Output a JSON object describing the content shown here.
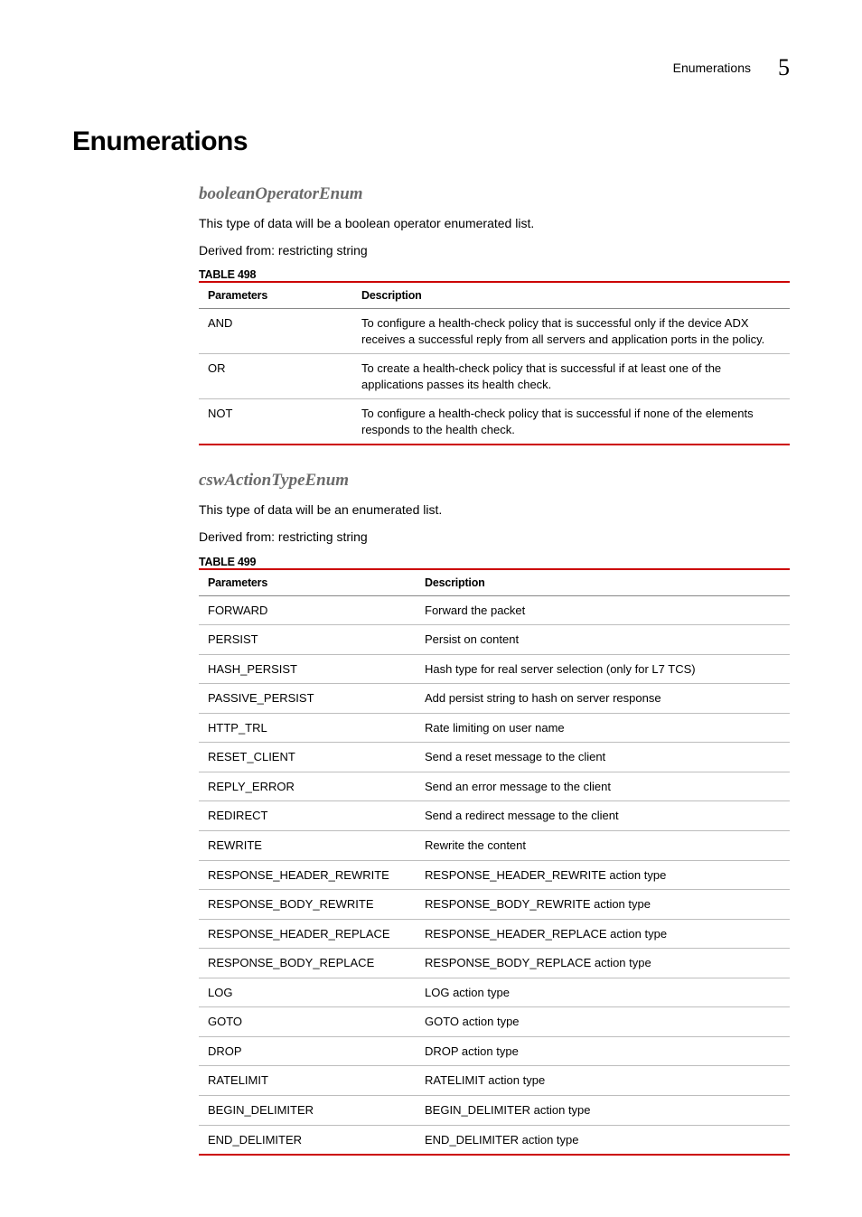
{
  "header": {
    "section": "Enumerations",
    "chapter_number": "5"
  },
  "title": "Enumerations",
  "sections": [
    {
      "heading": "booleanOperatorEnum",
      "intro": "This type of data will be a boolean operator enumerated list.",
      "derived": "Derived from: restricting string",
      "table_label": "TABLE 498",
      "table_class": "t498",
      "columns": [
        "Parameters",
        "Description"
      ],
      "rows": [
        {
          "p": "AND",
          "d": "To configure a health-check policy that is successful only if the device ADX receives a successful reply from all servers and application ports in the policy."
        },
        {
          "p": "OR",
          "d": "To create a health-check policy that is successful if at least one of the applications passes its health check."
        },
        {
          "p": "NOT",
          "d": "To configure a health-check policy that is successful if none of the elements responds to the health check."
        }
      ]
    },
    {
      "heading": "cswActionTypeEnum",
      "intro": "This type of data will be an enumerated list.",
      "derived": "Derived from: restricting string",
      "table_label": "TABLE 499",
      "table_class": "t499",
      "columns": [
        "Parameters",
        "Description"
      ],
      "rows": [
        {
          "p": "FORWARD",
          "d": "Forward the packet"
        },
        {
          "p": "PERSIST",
          "d": "Persist on content"
        },
        {
          "p": "HASH_PERSIST",
          "d": "Hash type for real server selection (only for L7 TCS)"
        },
        {
          "p": "PASSIVE_PERSIST",
          "d": "Add persist string to hash on server response"
        },
        {
          "p": "HTTP_TRL",
          "d": "Rate limiting on user name"
        },
        {
          "p": "RESET_CLIENT",
          "d": "Send a reset message to the client"
        },
        {
          "p": "REPLY_ERROR",
          "d": "Send an error message to the client"
        },
        {
          "p": "REDIRECT",
          "d": "Send a redirect message to the client"
        },
        {
          "p": "REWRITE",
          "d": "Rewrite the content"
        },
        {
          "p": "RESPONSE_HEADER_REWRITE",
          "d": "RESPONSE_HEADER_REWRITE action type"
        },
        {
          "p": "RESPONSE_BODY_REWRITE",
          "d": "RESPONSE_BODY_REWRITE action type"
        },
        {
          "p": "RESPONSE_HEADER_REPLACE",
          "d": "RESPONSE_HEADER_REPLACE action type"
        },
        {
          "p": "RESPONSE_BODY_REPLACE",
          "d": "RESPONSE_BODY_REPLACE action type"
        },
        {
          "p": "LOG",
          "d": "LOG action type"
        },
        {
          "p": "GOTO",
          "d": "GOTO action type"
        },
        {
          "p": "DROP",
          "d": "DROP action type"
        },
        {
          "p": "RATELIMIT",
          "d": "RATELIMIT action type"
        },
        {
          "p": "BEGIN_DELIMITER",
          "d": "BEGIN_DELIMITER action type"
        },
        {
          "p": "END_DELIMITER",
          "d": "END_DELIMITER action type"
        }
      ]
    }
  ]
}
